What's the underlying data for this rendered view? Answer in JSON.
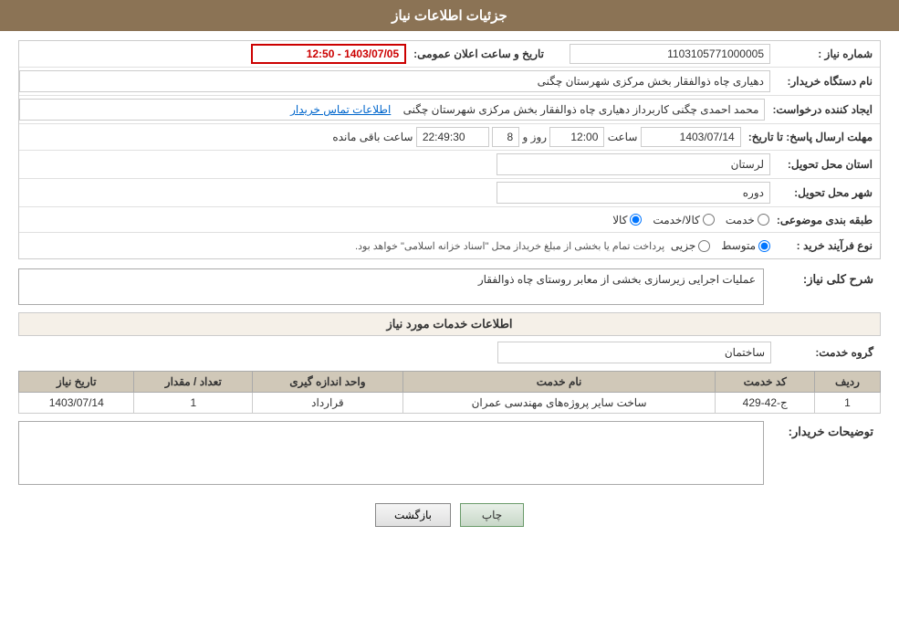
{
  "header": {
    "title": "جزئیات اطلاعات نیاز"
  },
  "fields": {
    "need_number_label": "شماره نیاز :",
    "need_number_value": "1103105771000005",
    "buyer_org_label": "نام دستگاه خریدار:",
    "buyer_org_value": "دهیاری چاه ذوالفقار بخش مرکزی شهرستان چگنی",
    "date_label": "تاریخ و ساعت اعلان عمومی:",
    "date_value": "1403/07/05 - 12:50",
    "creator_label": "ایجاد کننده درخواست:",
    "creator_value": "محمد احمدی چگنی کاربرداز دهیاری چاه ذوالفقار بخش مرکزی شهرستان چگنی",
    "contact_link": "اطلاعات تماس خریدار",
    "deadline_label": "مهلت ارسال پاسخ: تا تاریخ:",
    "deadline_date": "1403/07/14",
    "deadline_time_label": "ساعت",
    "deadline_time": "12:00",
    "deadline_days_label": "روز و",
    "deadline_days": "8",
    "deadline_remaining_label": "ساعت باقی مانده",
    "deadline_remaining": "22:49:30",
    "province_label": "استان محل تحویل:",
    "province_value": "لرستان",
    "city_label": "شهر محل تحویل:",
    "city_value": "دوره",
    "category_label": "طبقه بندی موضوعی:",
    "category_options": [
      "کالا",
      "خدمت",
      "کالا/خدمت"
    ],
    "category_selected": "کالا",
    "purchase_type_label": "نوع فرآیند خرید :",
    "purchase_type_options": [
      "جزیی",
      "متوسط"
    ],
    "purchase_type_selected": "متوسط",
    "purchase_note": "پرداخت تمام یا بخشی از مبلغ خریداز محل \"اسناد خزانه اسلامی\" خواهد بود.",
    "description_label": "شرح کلی نیاز:",
    "description_value": "عملیات اجرایی زیرسازی بخشی از معابر روستای چاه ذوالفقار",
    "services_section_title": "اطلاعات خدمات مورد نیاز",
    "service_group_label": "گروه خدمت:",
    "service_group_value": "ساختمان",
    "table": {
      "headers": [
        "ردیف",
        "کد خدمت",
        "نام خدمت",
        "واحد اندازه گیری",
        "تعداد / مقدار",
        "تاریخ نیاز"
      ],
      "rows": [
        {
          "row": "1",
          "code": "ج-42-429",
          "name": "ساخت سایر پروژه‌های مهندسی عمران",
          "unit": "قرارداد",
          "quantity": "1",
          "date": "1403/07/14"
        }
      ]
    },
    "buyer_notes_label": "توضیحات خریدار:",
    "buyer_notes_value": "",
    "btn_print": "چاپ",
    "btn_back": "بازگشت"
  }
}
